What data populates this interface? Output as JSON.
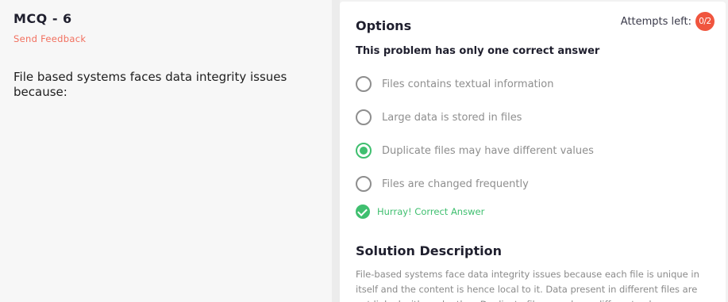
{
  "question": {
    "title": "MCQ - 6",
    "feedback_label": "Send Feedback",
    "text": "File based systems faces data integrity issues because:"
  },
  "options_panel": {
    "title": "Options",
    "attempts_label": "Attempts left:",
    "attempts_value": "0/2",
    "hint": "This problem has only one correct answer",
    "options": [
      {
        "label": "Files contains textual information",
        "selected": false
      },
      {
        "label": "Large data is stored in files",
        "selected": false
      },
      {
        "label": "Duplicate files may have different values",
        "selected": true
      },
      {
        "label": "Files are changed frequently",
        "selected": false
      }
    ],
    "result_label": "Hurray! Correct Answer"
  },
  "solution": {
    "title": "Solution Description",
    "text": "File-based systems face data integrity issues because each file is unique in itself and the content is hence local to it. Data present in different files are not linked with each other. Duplicate files may have different values."
  },
  "colors": {
    "accent_red": "#f0553e",
    "feedback": "#f2705f",
    "success": "#3fbf6f"
  }
}
